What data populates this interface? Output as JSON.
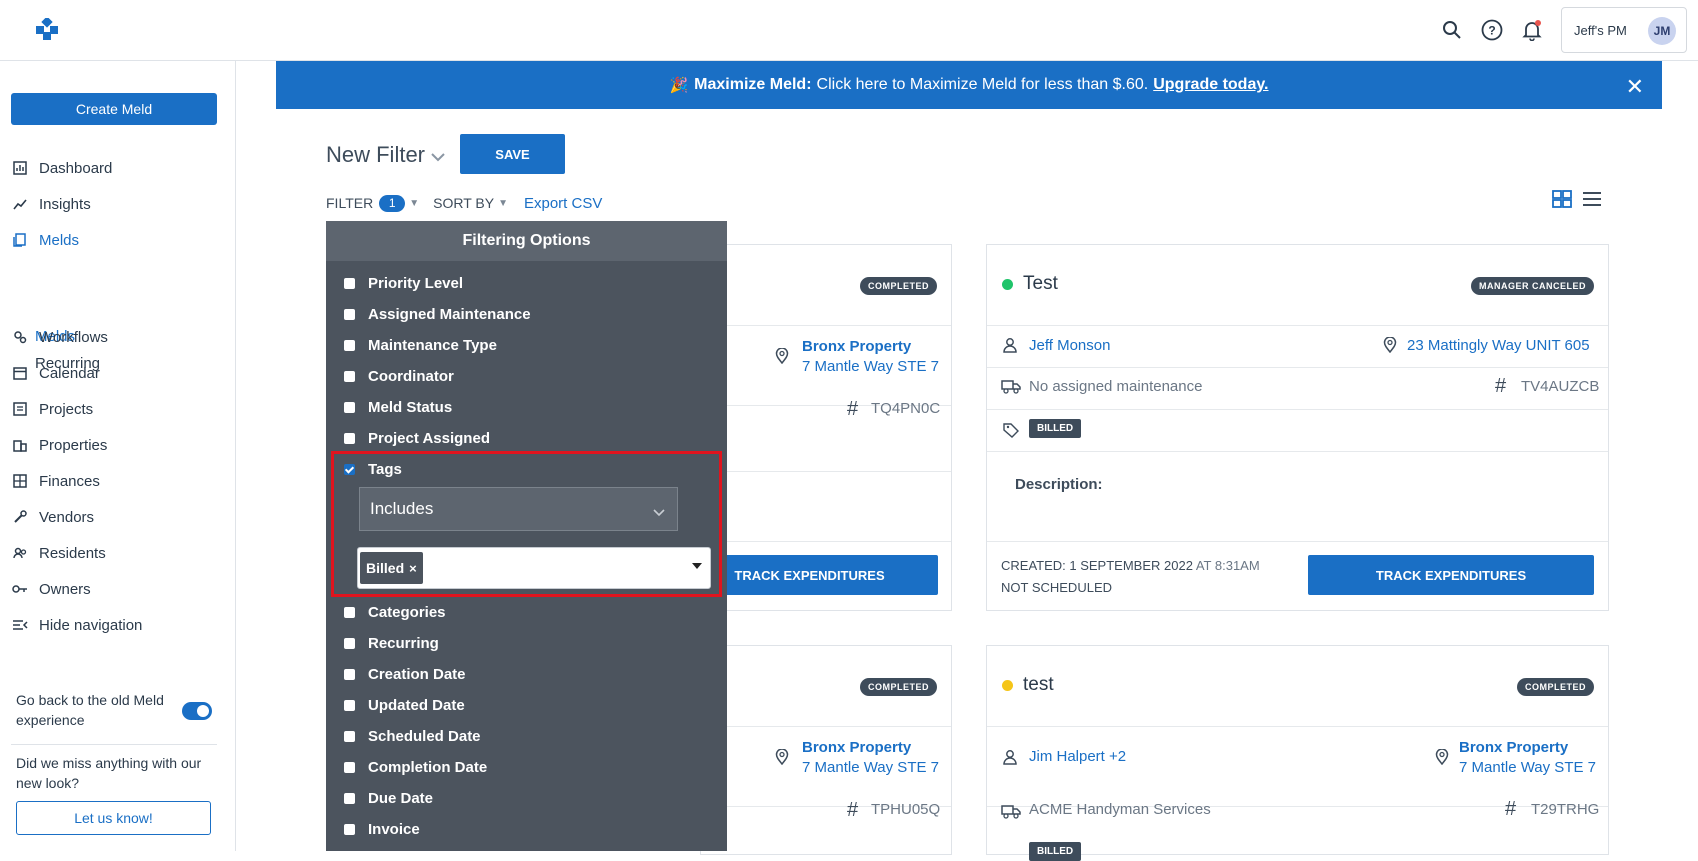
{
  "topbar": {
    "account_label": "Jeff's PM",
    "avatar_initials": "JM"
  },
  "sidebar": {
    "create_label": "Create Meld",
    "items": [
      {
        "label": "Dashboard",
        "icon": "dashboard-icon"
      },
      {
        "label": "Insights",
        "icon": "insights-icon"
      },
      {
        "label": "Melds",
        "icon": "melds-icon"
      },
      {
        "label": "Workflows",
        "icon": "workflows-icon"
      },
      {
        "label": "Calendar",
        "icon": "calendar-icon"
      },
      {
        "label": "Projects",
        "icon": "projects-icon"
      },
      {
        "label": "Properties",
        "icon": "properties-icon"
      },
      {
        "label": "Finances",
        "icon": "finances-icon"
      },
      {
        "label": "Vendors",
        "icon": "vendors-icon"
      },
      {
        "label": "Residents",
        "icon": "residents-icon"
      },
      {
        "label": "Owners",
        "icon": "owners-icon"
      },
      {
        "label": "Hide navigation",
        "icon": "hide-navigation-icon"
      }
    ],
    "sub_items": [
      "Melds",
      "Recurring"
    ],
    "old_experience": "Go back to the old Meld experience",
    "miss_text": "Did we miss anything with our new look?",
    "let_us_know": "Let us know!"
  },
  "banner": {
    "bold": "Maximize Meld:",
    "text": "Click here to Maximize Meld for less than $.60.",
    "link": "Upgrade today."
  },
  "toolbar": {
    "filter_name": "New Filter",
    "save_label": "SAVE",
    "filter_label": "FILTER",
    "filter_count": "1",
    "sort_label": "SORT BY",
    "export_label": "Export CSV"
  },
  "cards": {
    "card1": {
      "badge": "COMPLETED",
      "property_name": "Bronx Property",
      "property_address": "7 Mantle Way STE 7",
      "code": "TQ4PN0C",
      "track_label": "TRACK EXPENDITURES"
    },
    "card2": {
      "title": "Test",
      "badge": "MANAGER CANCELED",
      "resident": "Jeff Monson",
      "address": "23 Mattingly Way UNIT 605",
      "maintenance": "No assigned maintenance",
      "code": "TV4AUZCB",
      "tag": "BILLED",
      "description_label": "Description:",
      "created": "CREATED: 1 SEPTEMBER 2022",
      "created_time": "AT 8:31AM",
      "scheduled": "NOT SCHEDULED",
      "track_label": "TRACK EXPENDITURES",
      "status_color": "#1fc46a"
    },
    "card3": {
      "badge": "COMPLETED",
      "property_name": "Bronx Property",
      "property_address": "7 Mantle Way STE 7",
      "code": "TPHU05Q"
    },
    "card4": {
      "title": "test",
      "badge": "COMPLETED",
      "resident": "Jim Halpert +2",
      "property_name": "Bronx Property",
      "property_address": "7 Mantle Way STE 7",
      "maintenance": "ACME Handyman Services",
      "code": "T29TRHG",
      "tag": "BILLED",
      "status_color": "#f5c518"
    }
  },
  "filter_panel": {
    "title": "Filtering Options",
    "options_top": [
      "Priority Level",
      "Assigned Maintenance",
      "Maintenance Type",
      "Coordinator",
      "Meld Status",
      "Project Assigned"
    ],
    "tags_label": "Tags",
    "tags_mode": "Includes",
    "tags_selected": "Billed",
    "tags_remove": "×",
    "options_bottom": [
      "Categories",
      "Recurring",
      "Creation Date",
      "Updated Date",
      "Scheduled Date",
      "Completion Date",
      "Due Date",
      "Invoice"
    ]
  },
  "colors": {
    "primary": "#1a6fc5",
    "panel": "#4c545e",
    "highlight": "#e0141e"
  }
}
